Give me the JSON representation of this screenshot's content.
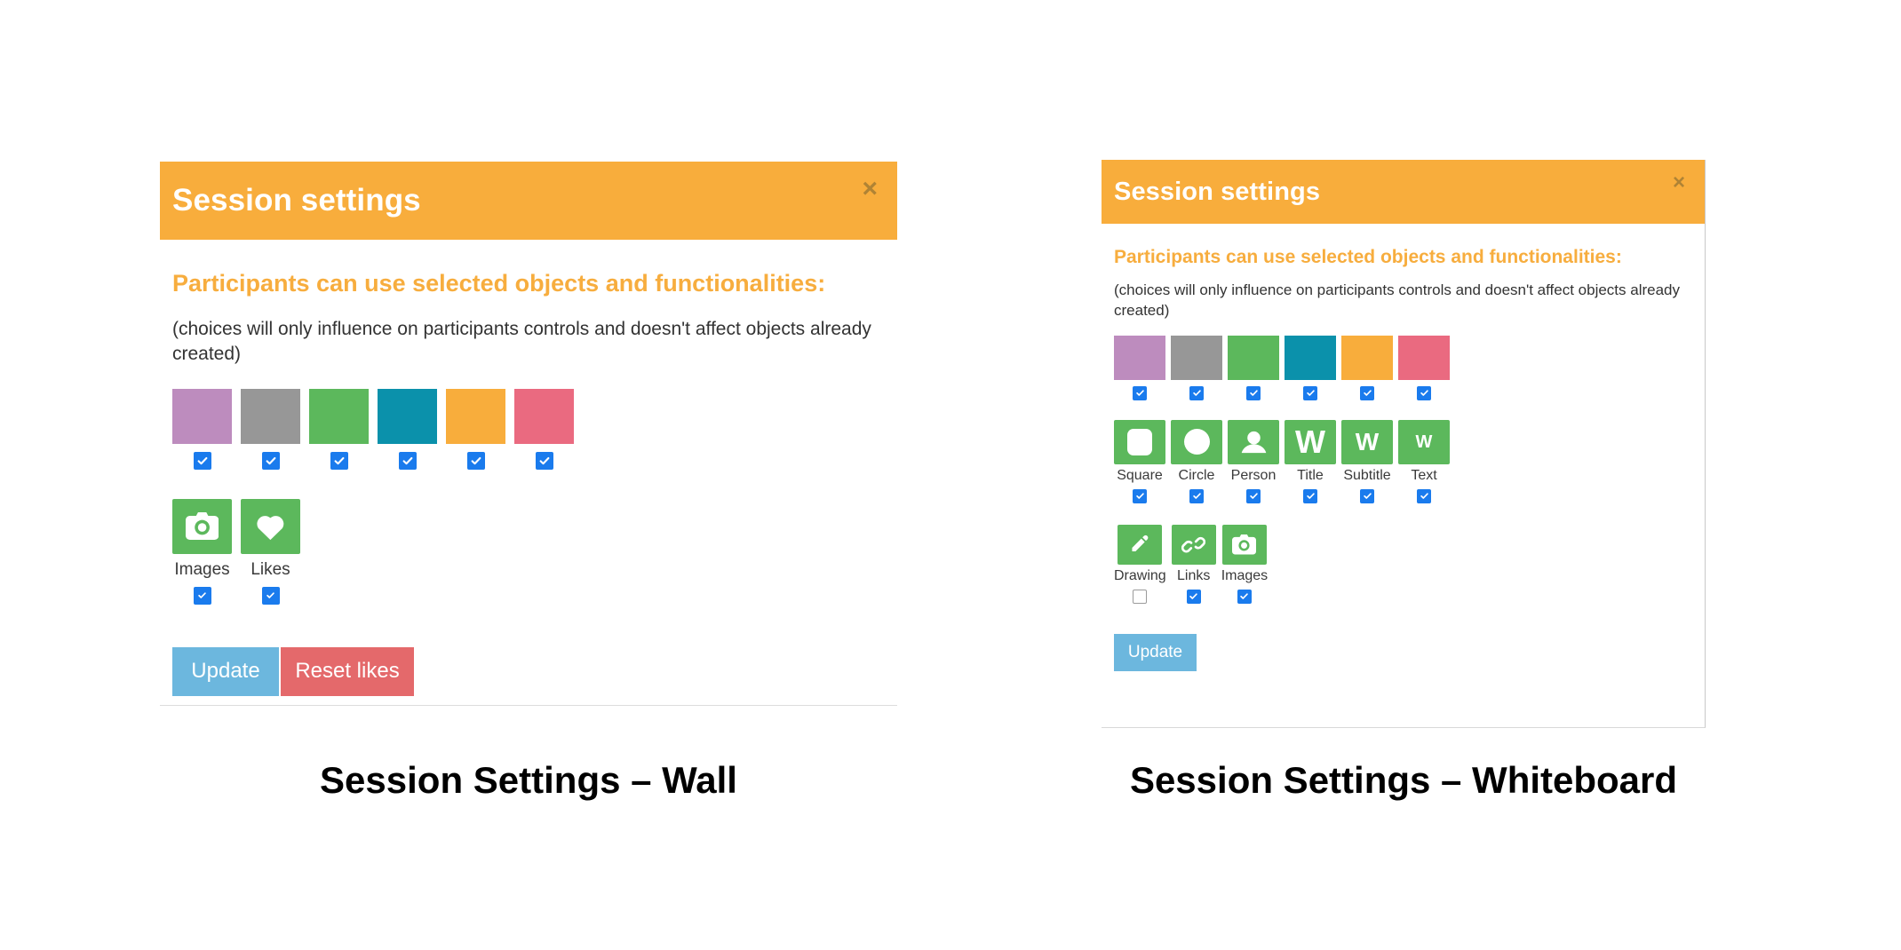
{
  "wall": {
    "title": "Session settings",
    "close_label": "×",
    "heading": "Participants can use selected objects and functionalities:",
    "note": "(choices will only influence on participants controls and doesn't affect objects already created)",
    "colors": [
      {
        "name": "purple",
        "hex": "#bd8cbe",
        "checked": true
      },
      {
        "name": "gray",
        "hex": "#979797",
        "checked": true
      },
      {
        "name": "green",
        "hex": "#5cb85c",
        "checked": true
      },
      {
        "name": "teal",
        "hex": "#0b91ab",
        "checked": true
      },
      {
        "name": "orange",
        "hex": "#f8ad3c",
        "checked": true
      },
      {
        "name": "pink",
        "hex": "#ea6a80",
        "checked": true
      }
    ],
    "functions": [
      {
        "label": "Images",
        "icon": "camera-icon",
        "checked": true
      },
      {
        "label": "Likes",
        "icon": "heart-icon",
        "checked": true
      }
    ],
    "buttons": {
      "update": "Update",
      "reset": "Reset likes"
    }
  },
  "whiteboard": {
    "title": "Session settings",
    "close_label": "×",
    "heading": "Participants can use selected objects and functionalities:",
    "note": "(choices will only influence on participants controls and doesn't affect objects already created)",
    "colors": [
      {
        "name": "purple",
        "hex": "#bd8cbe",
        "checked": true
      },
      {
        "name": "gray",
        "hex": "#979797",
        "checked": true
      },
      {
        "name": "green",
        "hex": "#5cb85c",
        "checked": true
      },
      {
        "name": "teal",
        "hex": "#0b91ab",
        "checked": true
      },
      {
        "name": "orange",
        "hex": "#f8ad3c",
        "checked": true
      },
      {
        "name": "pink",
        "hex": "#ea6a80",
        "checked": true
      }
    ],
    "objects": [
      {
        "label": "Square",
        "icon": "square-icon",
        "checked": true
      },
      {
        "label": "Circle",
        "icon": "circle-icon",
        "checked": true
      },
      {
        "label": "Person",
        "icon": "person-icon",
        "checked": true
      },
      {
        "label": "Title",
        "icon": "text-title-icon",
        "checked": true
      },
      {
        "label": "Subtitle",
        "icon": "text-subtitle-icon",
        "checked": true
      },
      {
        "label": "Text",
        "icon": "text-body-icon",
        "checked": true
      }
    ],
    "tools": [
      {
        "label": "Drawing",
        "icon": "pencil-icon",
        "checked": false
      },
      {
        "label": "Links",
        "icon": "link-icon",
        "checked": true
      },
      {
        "label": "Images",
        "icon": "camera-icon",
        "checked": true
      }
    ],
    "buttons": {
      "update": "Update"
    }
  },
  "captions": {
    "wall": "Session Settings – Wall",
    "whiteboard": "Session Settings – Whiteboard"
  },
  "theme": {
    "header_orange": "#f8ad3c",
    "heading_orange": "#f7ad3e",
    "checkbox_blue": "#1a7bed",
    "btn_update_blue": "#6cb7de",
    "btn_reset_red": "#e4696b",
    "tile_green": "#5cb85c"
  }
}
